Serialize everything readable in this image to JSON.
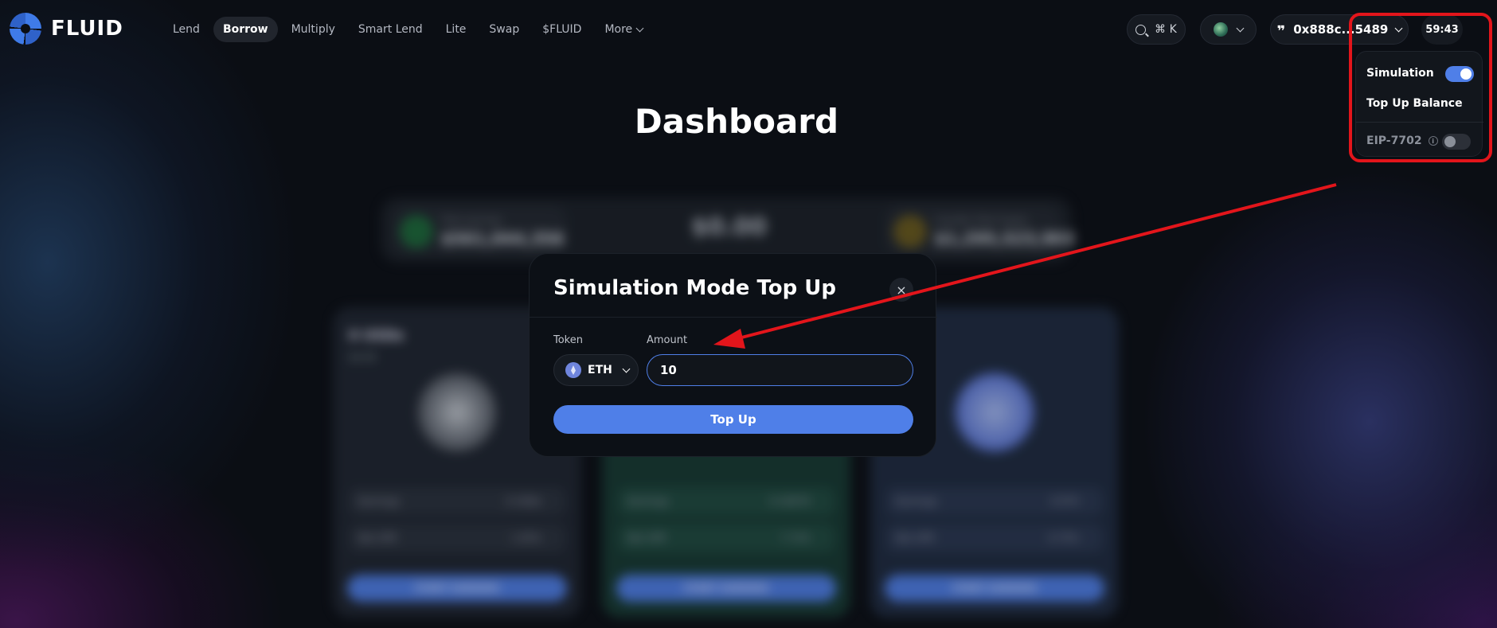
{
  "header": {
    "brand": "FLUID",
    "nav": [
      {
        "label": "Lend"
      },
      {
        "label": "Borrow"
      },
      {
        "label": "Multiply"
      },
      {
        "label": "Smart Lend"
      },
      {
        "label": "Lite"
      },
      {
        "label": "Swap"
      },
      {
        "label": "$FLUID"
      },
      {
        "label": "More"
      }
    ],
    "active_nav": "Borrow",
    "search_shortcut": "⌘ K",
    "wallet_address": "0x888c...5489",
    "timer": "59:43"
  },
  "dropdown": {
    "simulation_label": "Simulation",
    "simulation_enabled": true,
    "top_up_label": "Top Up Balance",
    "eip_label": "EIP-7702",
    "eip_enabled": false
  },
  "page": {
    "title": "Dashboard"
  },
  "background": {
    "stats": {
      "total_earnings_label": "Total earnings",
      "total_earnings_value": "$561,044,356",
      "center_value": "$0.00",
      "total_supply_label": "Liquidity Total Supply",
      "total_supply_value": "$1,295,523,903"
    },
    "cards": [
      {
        "title": "0 USDe",
        "sub": "$0.00",
        "row1_label": "Earnings",
        "row1_value": "0 USDe",
        "row2_label": "Net APR",
        "row2_value": "1.05%",
        "button": "START EARNING"
      },
      {
        "title": "",
        "sub": "",
        "row1_label": "Earnings",
        "row1_value": "0 USDT0",
        "row2_label": "Net APR",
        "row2_value": "7.72%",
        "button": "START EARNING"
      },
      {
        "title": "",
        "sub": "",
        "row1_label": "Earnings",
        "row1_value": "0 ETH",
        "row2_label": "Net APR",
        "row2_value": "0.75%",
        "button": "START EARNING"
      }
    ]
  },
  "modal": {
    "title": "Simulation Mode Top Up",
    "close_label": "×",
    "token_label": "Token",
    "token_value": "ETH",
    "amount_label": "Amount",
    "amount_value": "10",
    "submit_label": "Top Up"
  },
  "colors": {
    "accent": "#4f7fe8",
    "highlight": "#e3151b",
    "background": "#0b0e14"
  }
}
